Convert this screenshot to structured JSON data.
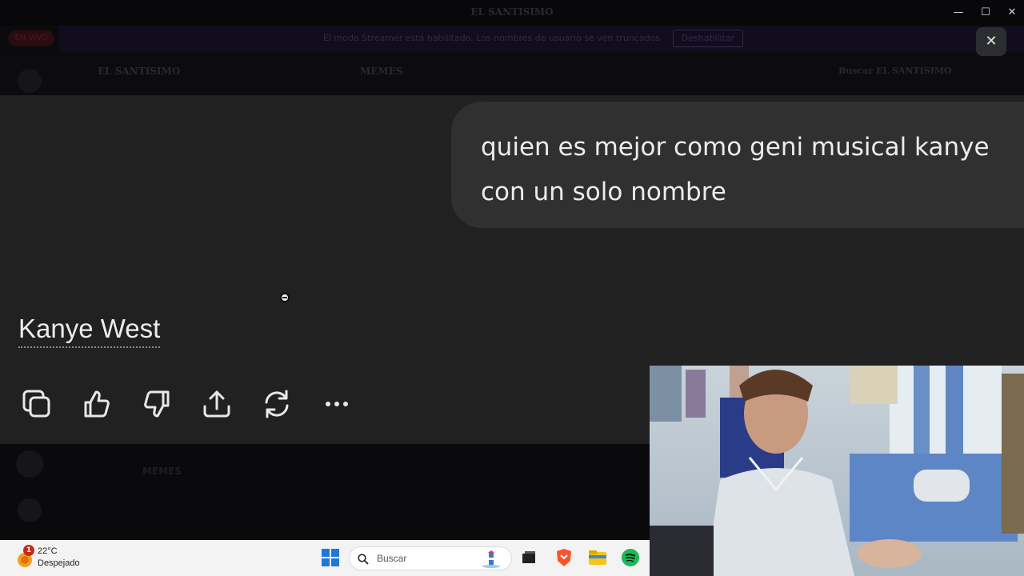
{
  "window": {
    "title": "EL SANTISIMO",
    "minimize": "—",
    "maximize": "☐",
    "close": "✕"
  },
  "background": {
    "banner_text": "El modo Streamer está habilitado. Los nombres de usuario se ven truncados",
    "banner_button": "Deshabilitar",
    "live_pill": "EN VIVO",
    "server_name": "EL SANTISIMO",
    "channel_name": "MEMES",
    "search_placeholder": "Buscar EL SANTISIMO",
    "bottom_channel": "MEMES"
  },
  "overlay": {
    "close_label": "✕"
  },
  "chat": {
    "user_message_line1": "quien es mejor  como geni musical kanye",
    "user_message_line2": "con un solo nombre",
    "answer": "Kanye West"
  },
  "actions": [
    {
      "name": "copy-icon"
    },
    {
      "name": "thumbs-up-icon"
    },
    {
      "name": "thumbs-down-icon"
    },
    {
      "name": "share-icon"
    },
    {
      "name": "regenerate-icon"
    },
    {
      "name": "more-icon"
    }
  ],
  "taskbar": {
    "weather_badge": "1",
    "temperature": "22°C",
    "condition": "Despejado",
    "search_placeholder": "Buscar"
  },
  "colors": {
    "chat_bg": "#212121",
    "bubble_bg": "#303030",
    "text": "#ececec",
    "taskbar_bg": "#f3f3f3"
  }
}
